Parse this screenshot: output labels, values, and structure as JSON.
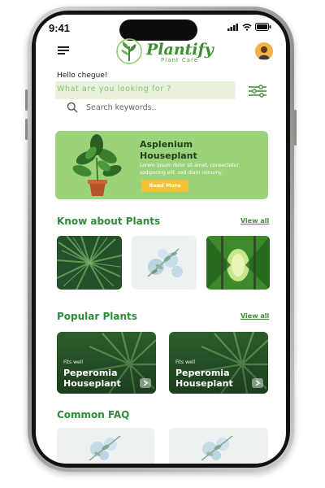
{
  "status_bar": {
    "time": "9:41"
  },
  "app": {
    "name": "Plantify",
    "tagline": "Plant Care"
  },
  "greeting": "Hello chegue!",
  "prompt": "What are you looking for ?",
  "search": {
    "placeholder": "Search keywords.."
  },
  "banner": {
    "title_line1": "Asplenium",
    "title_line2": "Houseplant",
    "body": "Lorem ipsum dolor sit amet, consectetur sodipscing elit, sed diam nonumy",
    "button": "Read More"
  },
  "sections": {
    "know": {
      "title": "Know about Plants",
      "link": "View all"
    },
    "popular": {
      "title": "Popular Plants",
      "link": "View all"
    },
    "faq": {
      "title": "Common FAQ"
    }
  },
  "popular_cards": [
    {
      "badge": "Fits well",
      "name_line1": "Peperomia",
      "name_line2": "Houseplant"
    },
    {
      "badge": "Fits well",
      "name_line1": "Peperomia",
      "name_line2": "Houseplant"
    }
  ],
  "colors": {
    "brand_green": "#3c8f2f",
    "banner_green": "#9bd27a",
    "accent_yellow": "#f6c233",
    "question_bg": "#e7f1dd"
  },
  "icons": [
    "menu-icon",
    "leaf-logo-icon",
    "avatar",
    "search-icon",
    "filter-icon",
    "arrow-right-icon",
    "signal-icon",
    "wifi-icon",
    "battery-icon"
  ]
}
